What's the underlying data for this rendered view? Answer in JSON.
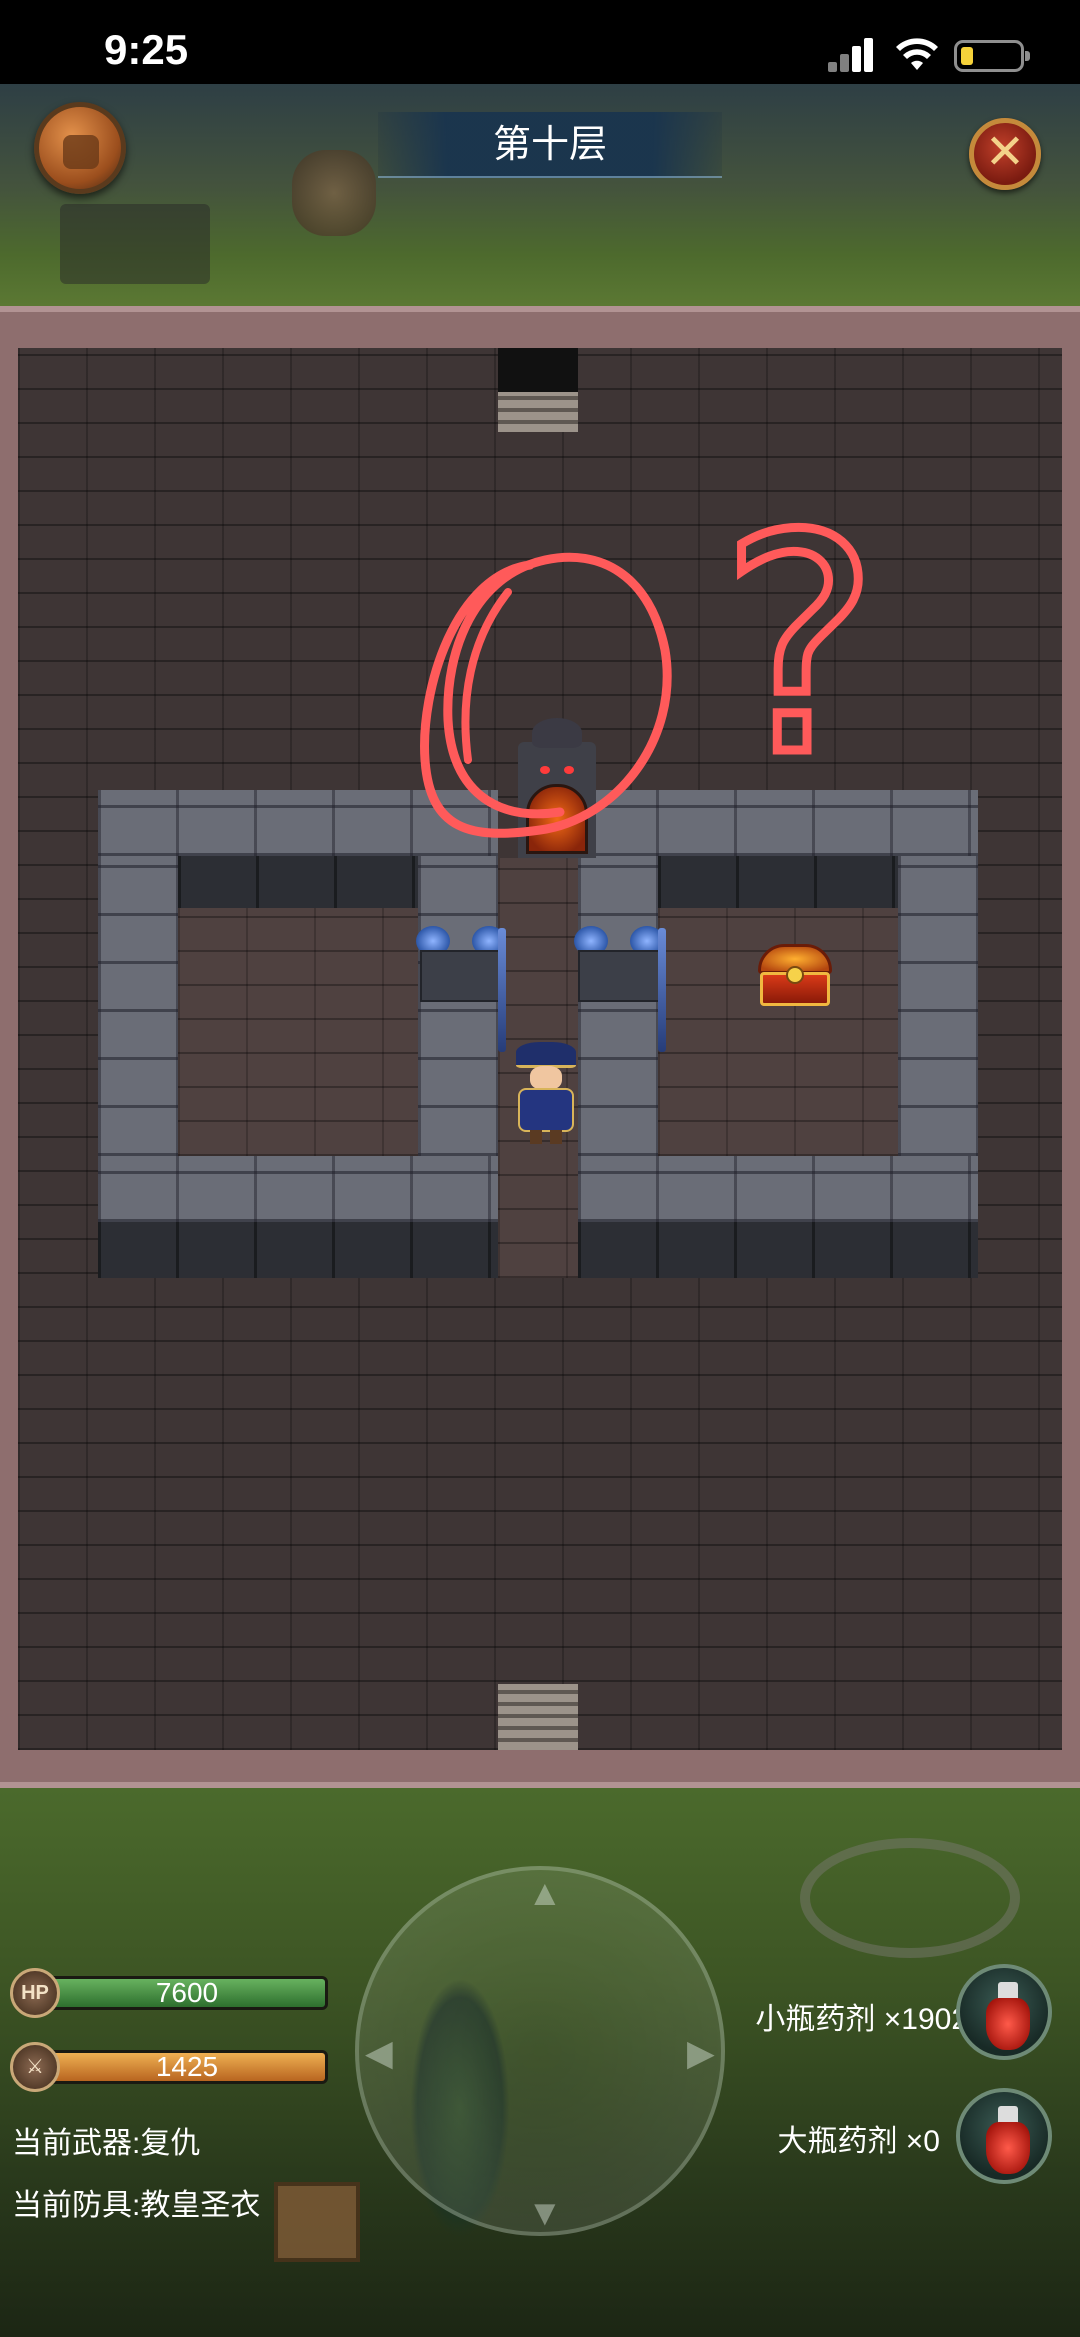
{
  "status_bar": {
    "time": "9:25"
  },
  "header": {
    "floor_title": "第十层",
    "bag_icon": "backpack-icon",
    "close_icon": "close-x-icon"
  },
  "colors": {
    "hp_bar": "#4f9a4a",
    "attack_bar": "#de8d34",
    "annotation": "#ff5555"
  },
  "stats": {
    "hp_badge": "HP",
    "hp": "7600",
    "attack_icon": "sword-icon",
    "attack": "1425"
  },
  "equipment": {
    "weapon": "当前武器:复仇",
    "armor": "当前防具:教皇圣衣"
  },
  "potions": {
    "small": "小瓶药剂 ×1902",
    "large": "大瓶药剂 ×0"
  },
  "map": {
    "objects": [
      "stairs-up",
      "stairs-down",
      "demon-door",
      "treasure-chest",
      "hero",
      "guardian-statues"
    ],
    "annotation_mark": "?"
  }
}
